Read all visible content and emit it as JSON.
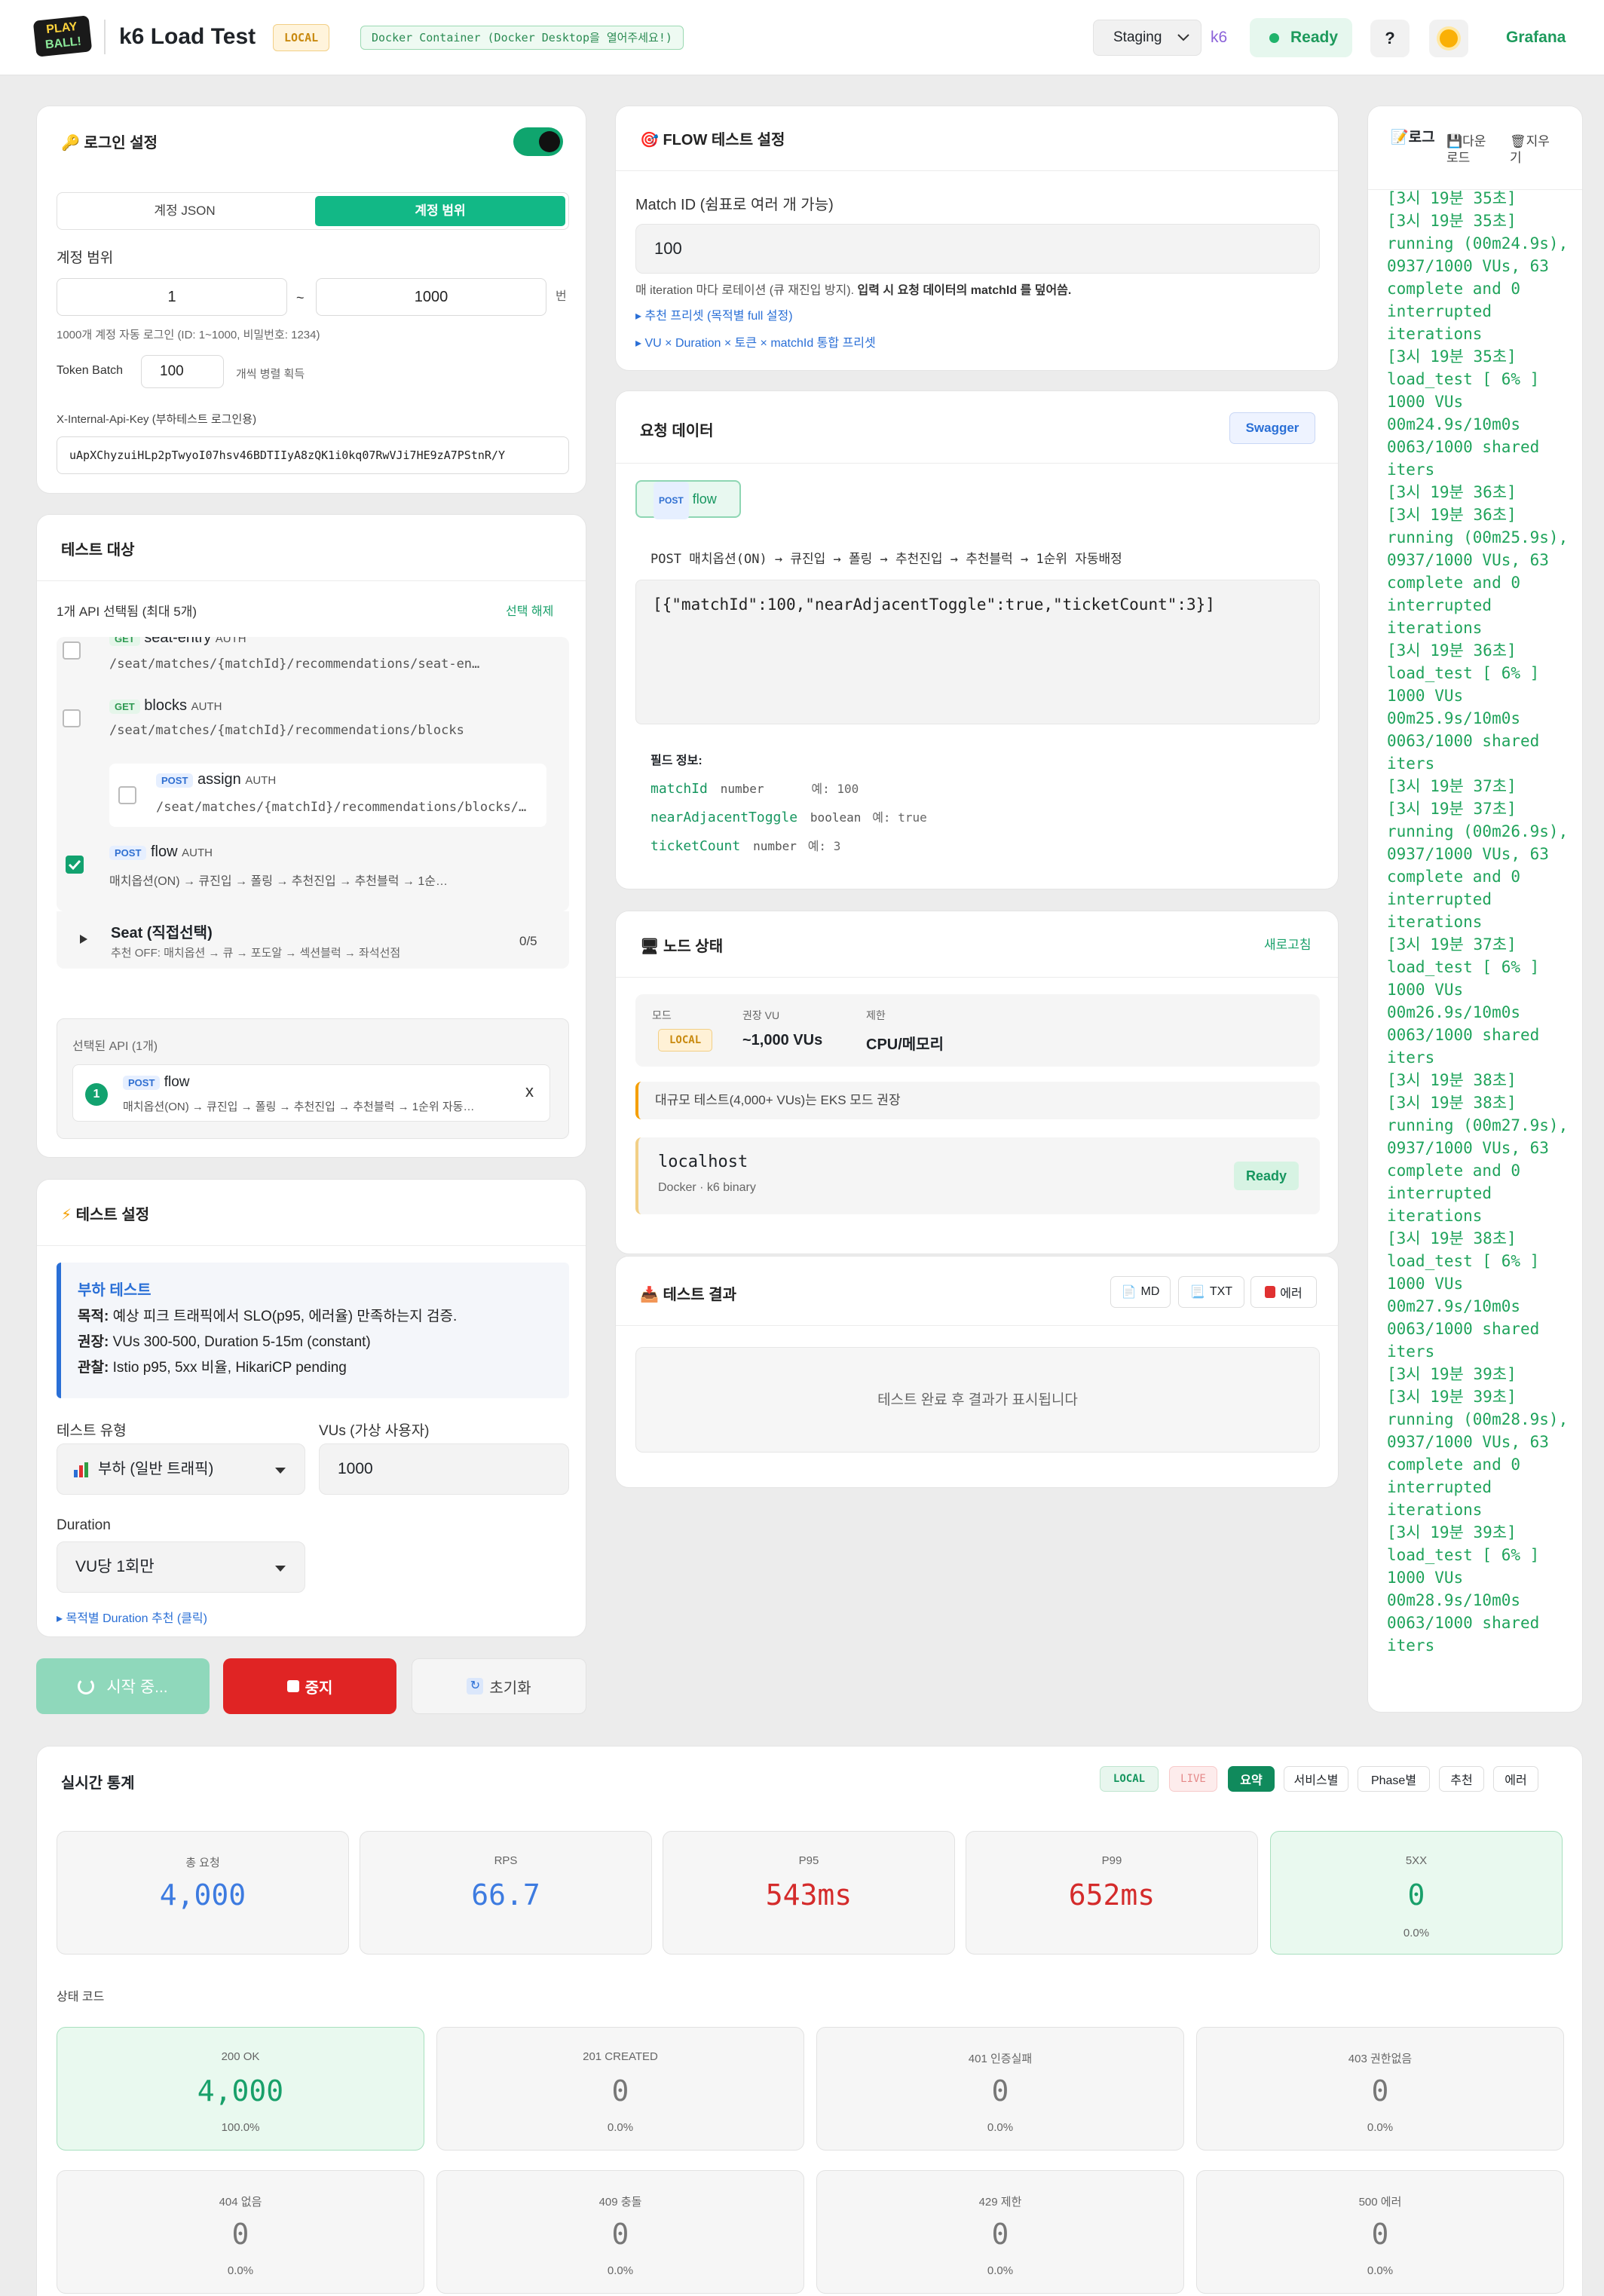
{
  "header": {
    "logo_line1": "PLAY",
    "logo_line2": "BALL!",
    "title": "k6 Load Test",
    "env_badge": "LOCAL",
    "docker_note": "Docker Container (Docker Desktop을 열어주세요!)",
    "env_select": "Staging",
    "k6_label": "k6",
    "status": "Ready",
    "help": "?",
    "grafana": "Grafana"
  },
  "login": {
    "title": "로그인 설정",
    "tab_json": "계정 JSON",
    "tab_range": "계정 범위",
    "range_label": "계정 범위",
    "range_from": "1",
    "tilde": "~",
    "range_to": "1000",
    "unit": "번",
    "range_note": "1000개 계정 자동 로그인 (ID: 1~1000, 비밀번호: 1234)",
    "token_batch_label": "Token Batch",
    "token_batch": "100",
    "token_batch_note": "개씩 병렬 획득",
    "api_key_label": "X-Internal-Api-Key (부하테스트 로그인용)",
    "api_key": "uApXChyzuiHLp2pTwyoI07hsv46BDTIIyA8zQK1i0kq07RwVJi7HE9zA7PStnR/Y"
  },
  "target": {
    "title": "테스트 대상",
    "count_note": "1개 API 선택됨 (최대 5개)",
    "clear": "선택 해제",
    "items": [
      {
        "method": "GET",
        "name": "seat-entry",
        "auth": "AUTH",
        "path": "/seat/matches/{matchId}/recommendations/seat-en…"
      },
      {
        "method": "GET",
        "name": "blocks",
        "auth": "AUTH",
        "path": "/seat/matches/{matchId}/recommendations/blocks"
      },
      {
        "method": "POST",
        "name": "assign",
        "auth": "AUTH",
        "path": "/seat/matches/{matchId}/recommendations/blocks/…"
      },
      {
        "method": "POST",
        "name": "flow",
        "auth": "AUTH",
        "path": "매치옵션(ON) → 큐진입 → 폴링 → 추천진입 → 추천블럭 → 1순…"
      }
    ],
    "group_name": "Seat (직접선택)",
    "group_desc": "추천 OFF: 매치옵션 → 큐 → 포도알 → 섹션블럭 → 좌석선점",
    "group_count": "0/5",
    "selected_title": "선택된 API (1개)",
    "selected_index": "1",
    "selected_method": "POST",
    "selected_name": "flow",
    "selected_desc": "매치옵션(ON) → 큐진입 → 폴링 → 추천진입 → 추천블럭 → 1순위 자동…",
    "remove": "x"
  },
  "testcfg": {
    "title": "테스트 설정",
    "info_title": "부하 테스트",
    "purpose_k": "목적:",
    "purpose_v": " 예상 피크 트래픽에서 SLO(p95, 에러율) 만족하는지 검증.",
    "rec_k": "권장:",
    "rec_v": " VUs 300-500, Duration 5-15m (constant)",
    "obs_k": "관찰:",
    "obs_v": " Istio p95, 5xx 비율, HikariCP pending",
    "type_label": "테스트 유형",
    "type_value": "부하 (일반 트래픽)",
    "vus_label": "VUs (가상 사용자)",
    "vus_value": "1000",
    "duration_label": "Duration",
    "duration_value": "VU당 1회만",
    "duration_hint": "▸ 목적별 Duration 추천 (클릭)"
  },
  "actions": {
    "start": "시작 중...",
    "stop": "중지",
    "reset": "초기화"
  },
  "flow": {
    "title": "FLOW 테스트 설정",
    "match_label": "Match ID (쉼표로 여러 개 가능)",
    "match_value": "100",
    "note_plain": "매 iteration 마다 로테이션 (큐 재진입 방지).",
    "note_bold": "입력 시 요청 데이터의 matchId 를 덮어씀.",
    "preset1": "▸ 추천 프리셋 (목적별 full 설정)",
    "preset2": "▸ VU × Duration × 토큰 × matchId 통합 프리셋"
  },
  "request": {
    "title": "요청 데이터",
    "swagger": "Swagger",
    "method": "POST",
    "name": "flow",
    "flow_desc": "POST 매치옵션(ON) → 큐진입 → 폴링 → 추천진입 → 추천블럭 → 1순위 자동배정",
    "body": "[{\"matchId\":100,\"nearAdjacentToggle\":true,\"ticketCount\":3}]",
    "fields_title": "필드 정보:",
    "fields": [
      {
        "name": "matchId",
        "type": "number",
        "ex": "예: 100"
      },
      {
        "name": "nearAdjacentToggle",
        "type": "boolean",
        "ex": "예: true"
      },
      {
        "name": "ticketCount",
        "type": "number",
        "ex": "예: 3"
      }
    ]
  },
  "node": {
    "title": "노드 상태",
    "refresh": "새로고침",
    "mode_k": "모드",
    "mode_v": "LOCAL",
    "vu_k": "권장 VU",
    "vu_v": "~1,000 VUs",
    "limit_k": "제한",
    "limit_v": "CPU/메모리",
    "warn": "대규모 테스트(4,000+ VUs)는 EKS 모드 권장",
    "host": "localhost",
    "host_sub": "Docker · k6 binary",
    "host_status": "Ready"
  },
  "result": {
    "title": "테스트 결과",
    "md": "MD",
    "txt": "TXT",
    "err": "에러",
    "empty": "테스트 완료 후 결과가 표시됩니다"
  },
  "log": {
    "tab_log": "로그",
    "tab_down": "다운로드",
    "tab_clear": "지우기",
    "lines": [
      "[3시 19분 35초]",
      "[3시 19분 35초]",
      "running (00m24.9s),",
      "0937/1000 VUs, 63",
      "complete and 0",
      "interrupted",
      "iterations",
      "[3시 19분 35초]",
      "load_test [ 6% ]",
      "1000 VUs",
      "00m24.9s/10m0s",
      "0063/1000 shared",
      "iters",
      "[3시 19분 36초]",
      "[3시 19분 36초]",
      "running (00m25.9s),",
      "0937/1000 VUs, 63",
      "complete and 0",
      "interrupted",
      "iterations",
      "[3시 19분 36초]",
      "load_test [ 6% ]",
      "1000 VUs",
      "00m25.9s/10m0s",
      "0063/1000 shared",
      "iters",
      "[3시 19분 37초]",
      "[3시 19분 37초]",
      "running (00m26.9s),",
      "0937/1000 VUs, 63",
      "complete and 0",
      "interrupted",
      "iterations",
      "[3시 19분 37초]",
      "load_test [ 6% ]",
      "1000 VUs",
      "00m26.9s/10m0s",
      "0063/1000 shared",
      "iters",
      "[3시 19분 38초]",
      "[3시 19분 38초]",
      "running (00m27.9s),",
      "0937/1000 VUs, 63",
      "complete and 0",
      "interrupted",
      "iterations",
      "[3시 19분 38초]",
      "load_test [ 6% ]",
      "1000 VUs",
      "00m27.9s/10m0s",
      "0063/1000 shared",
      "iters",
      "[3시 19분 39초]",
      "[3시 19분 39초]",
      "running (00m28.9s),",
      "0937/1000 VUs, 63",
      "complete and 0",
      "interrupted",
      "iterations",
      "[3시 19분 39초]",
      "load_test [ 6% ]",
      "1000 VUs",
      "00m28.9s/10m0s",
      "0063/1000 shared",
      "iters"
    ]
  },
  "stats": {
    "title": "실시간 통계",
    "badge_local": "LOCAL",
    "badge_live": "LIVE",
    "tabs": [
      "요약",
      "서비스별",
      "Phase별",
      "추천",
      "에러"
    ],
    "summary": [
      {
        "t": "총 요청",
        "v": "4,000"
      },
      {
        "t": "RPS",
        "v": "66.7"
      },
      {
        "t": "P95",
        "v": "543ms"
      },
      {
        "t": "P99",
        "v": "652ms"
      },
      {
        "t": "5XX",
        "v": "0",
        "p": "0.0%"
      }
    ],
    "codes_title": "상태 코드",
    "codes": [
      {
        "t": "200 OK",
        "v": "4,000",
        "p": "100.0%"
      },
      {
        "t": "201 CREATED",
        "v": "0",
        "p": "0.0%"
      },
      {
        "t": "401 인증실패",
        "v": "0",
        "p": "0.0%"
      },
      {
        "t": "403 권한없음",
        "v": "0",
        "p": "0.0%"
      },
      {
        "t": "404 없음",
        "v": "0",
        "p": "0.0%"
      },
      {
        "t": "409 충돌",
        "v": "0",
        "p": "0.0%"
      },
      {
        "t": "429 제한",
        "v": "0",
        "p": "0.0%"
      },
      {
        "t": "500 에러",
        "v": "0",
        "p": "0.0%"
      }
    ]
  },
  "colors": {
    "accent": "#12b886",
    "danger": "#e02424",
    "blue": "#2a6fd6",
    "log_green": "#1fa35b"
  }
}
